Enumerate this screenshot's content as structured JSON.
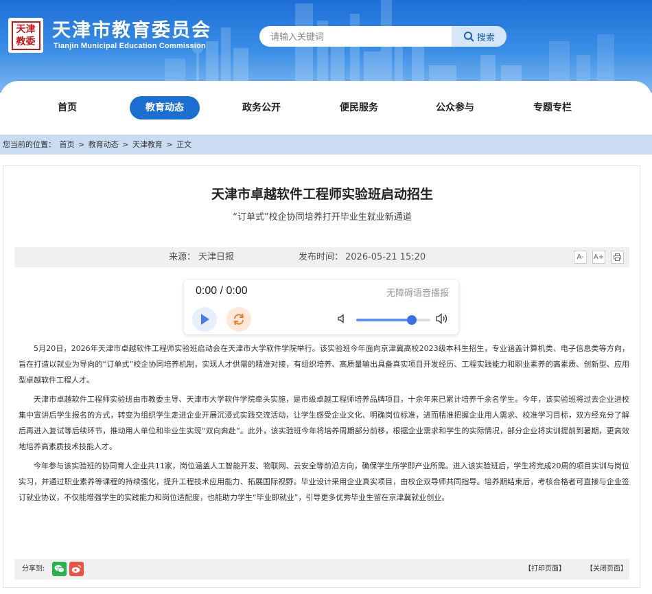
{
  "header": {
    "logo_text": "天津教委",
    "site_title": "天津市教育委员会",
    "site_subtitle": "Tianjin Municipal Education Commission",
    "search_placeholder": "请输入关键词",
    "search_button": "搜索"
  },
  "nav": {
    "items": [
      {
        "label": "首页"
      },
      {
        "label": "教育动态"
      },
      {
        "label": "政务公开"
      },
      {
        "label": "便民服务"
      },
      {
        "label": "公众参与"
      },
      {
        "label": "专题专栏"
      }
    ],
    "active": "教育动态"
  },
  "breadcrumb": {
    "prefix": "您当前的位置：",
    "items": [
      "首页",
      "教育动态",
      "天津教育",
      "正文"
    ],
    "separator": ">"
  },
  "article": {
    "title": "天津市卓越软件工程师实验班启动招生",
    "subtitle": "“订单式”校企协同培养打开毕业生就业新通道",
    "source_label": "来源：",
    "source": "天津日报",
    "time_label": "发布时间：",
    "time": "2026-05-21 15:20",
    "tools": [
      "A-",
      "A+",
      "print"
    ],
    "paragraphs": [
      "5月20日，2026年天津市卓越软件工程师实验班启动会在天津市大学软件学院举行。该实验班今年面向京津冀高校2023级本科生招生，专业涵盖计算机类、电子信息类等方向，旨在打造以就业为导向的“订单式”校企协同培养机制，实现人才供需的精准对接，有组织培养、高质量输出具备真实项目开发经历、工程实践能力和职业素养的高素质、创新型、应用型卓越软件工程人才。",
      "天津市卓越软件工程师实验班由市教委主导、天津市大学软件学院牵头实施，是市级卓越工程师培养品牌项目，十余年来已累计培养千余名学生。今年，该实验班将过去企业进校集中宣讲后学生报名的方式，转变为组织学生走进企业开展沉浸式实践交流活动，让学生感受企业文化、明确岗位标准，进而精准把握企业用人需求、校准学习目标，双方经充分了解后再进入复试等后续环节，推动用人单位和毕业生实现“双向奔赴”。此外，该实验班今年将培养周期部分前移，根据企业需求和学生的实际情况，部分企业将实训提前到暑期，更高效地培养高素质技术技能人才。",
      "今年参与该实验班的协同育人企业共11家，岗位涵盖人工智能开发、物联网、云安全等前沿方向，确保学生所学即产业所需。进入该实验班后，学生将完成20周的项目实训与岗位实习，并通过职业素养等课程的持续强化，提升工程技术应用能力、拓展国际视野。毕业设计采用企业真实项目，由校企双导师共同指导。培养期结束后，考核合格者可直接与企业签订就业协议，不仅能增强学生的实践能力和岗位适配度，也能助力学生“毕业即就业”，引导更多优秀毕业生留在京津冀就业创业。"
    ]
  },
  "player": {
    "time_display": "0:00 / 0:00",
    "accessibility_label": "无障碍语音播报",
    "volume_level": 0.75
  },
  "footer": {
    "share_label": "分享到:",
    "share_targets": [
      "wechat",
      "weibo"
    ],
    "print_label": "【打印页面】",
    "close_label": "【关闭页面】"
  },
  "colors": {
    "brand_blue": "#1a6fd1",
    "breadcrumb_bg": "#c9dcf1",
    "seal_red": "#c8161d"
  }
}
